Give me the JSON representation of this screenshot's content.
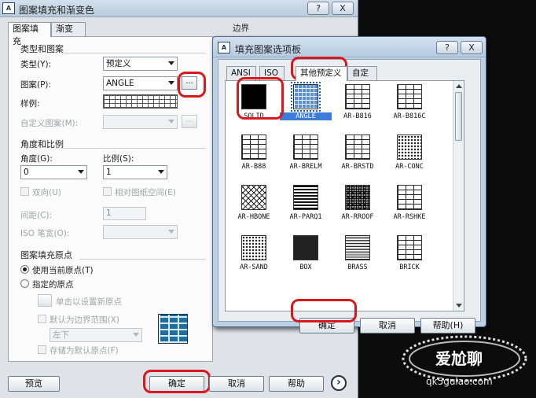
{
  "main_dialog": {
    "title": "图案填充和渐变色",
    "help_btn": "?",
    "close_btn": "X",
    "tabs": [
      "图案填充",
      "渐变色"
    ],
    "boundary_label": "边界",
    "type_group": {
      "title": "类型和图案",
      "type_label": "类型(Y):",
      "type_value": "预定义",
      "pattern_label": "图案(P):",
      "pattern_value": "ANGLE",
      "browse_btn": "...",
      "sample_label": "样例:",
      "custom_label": "自定义图案(M):",
      "custom_btn": "..."
    },
    "angle_group": {
      "title": "角度和比例",
      "angle_label": "角度(G):",
      "angle_value": "0",
      "scale_label": "比例(S):",
      "scale_value": "1",
      "double_label": "双向(U)",
      "relative_label": "相对图纸空间(E)",
      "spacing_label": "间距(C):",
      "spacing_value": "1",
      "iso_label": "ISO 笔宽(O):"
    },
    "origin_group": {
      "title": "图案填充原点",
      "use_current": "使用当前原点(T)",
      "specified": "指定的原点",
      "click_set": "单击以设置新原点",
      "default_boundary": "默认为边界范围(X)",
      "position_value": "左下",
      "store_default": "存储为默认原点(F)"
    },
    "footer": {
      "preview": "预览",
      "ok": "确定",
      "cancel": "取消",
      "help": "帮助",
      "more": "›"
    }
  },
  "palette_dialog": {
    "title": "填充图案选项板",
    "help_btn": "?",
    "close_btn": "X",
    "tabs": [
      "ANSI",
      "ISO",
      "其他预定义",
      "自定义"
    ],
    "patterns": [
      {
        "name": "SOLID",
        "style": "p-solid"
      },
      {
        "name": "ANGLE",
        "style": "p-angle"
      },
      {
        "name": "AR-B816",
        "style": "p-brick"
      },
      {
        "name": "AR-B816C",
        "style": "p-brick"
      },
      {
        "name": "AR-B88",
        "style": "p-brick"
      },
      {
        "name": "AR-BRELM",
        "style": "p-brick"
      },
      {
        "name": "AR-BRSTD",
        "style": "p-brick"
      },
      {
        "name": "AR-CONC",
        "style": "p-dot"
      },
      {
        "name": "AR-HBONE",
        "style": "p-herring"
      },
      {
        "name": "AR-PARQ1",
        "style": "p-parq"
      },
      {
        "name": "AR-RROOF",
        "style": "p-dense"
      },
      {
        "name": "AR-RSHKE",
        "style": "p-brick"
      },
      {
        "name": "AR-SAND",
        "style": "p-dot"
      },
      {
        "name": "BOX",
        "style": "p-box"
      },
      {
        "name": "BRASS",
        "style": "p-brass"
      },
      {
        "name": "BRICK",
        "style": "p-brick"
      }
    ],
    "ok": "确定",
    "cancel": "取消",
    "help": "帮助(H)"
  },
  "watermark": {
    "text": "爱尬聊",
    "url": "qk5gulao.com"
  },
  "colors": {
    "highlight_ring": "#d9171e",
    "selection": "#3b7dd8"
  }
}
